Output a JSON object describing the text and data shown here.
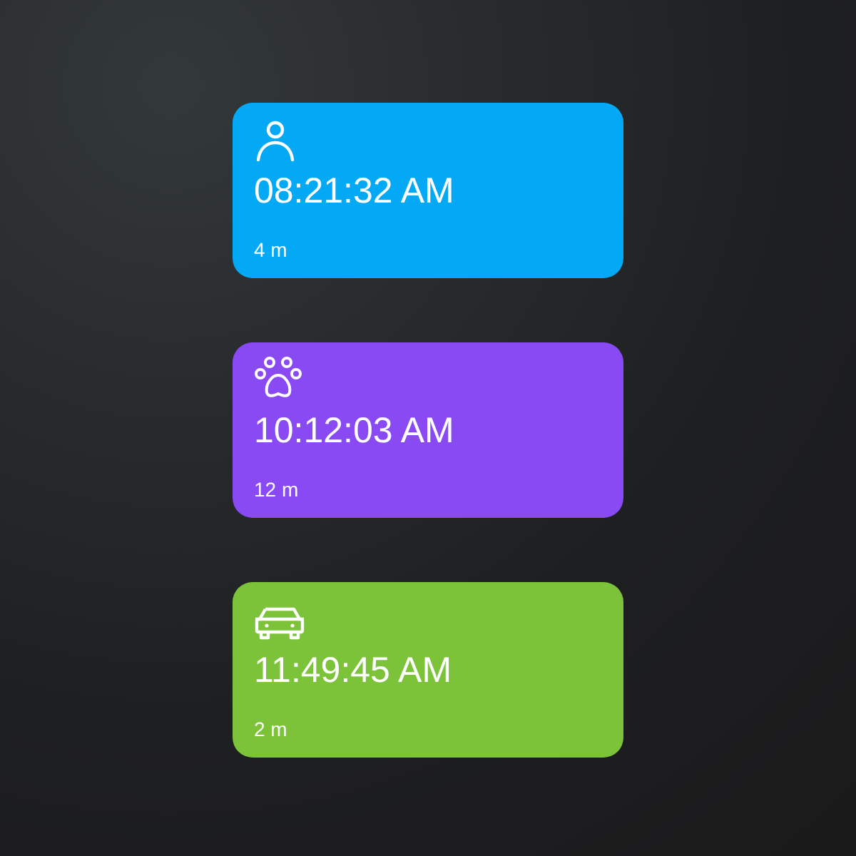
{
  "cards": [
    {
      "kind": "person",
      "color": "#03a9f4",
      "time": "08:21:32 AM",
      "duration": "4 m"
    },
    {
      "kind": "paw",
      "color": "#8a4af3",
      "time": "10:12:03 AM",
      "duration": "12 m"
    },
    {
      "kind": "car",
      "color": "#7cc33a",
      "time": "11:49:45 AM",
      "duration": "2 m"
    }
  ]
}
